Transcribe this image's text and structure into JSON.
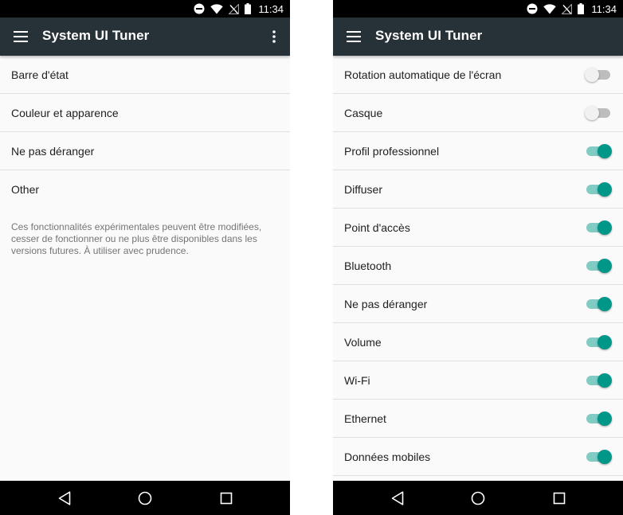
{
  "status_bar": {
    "time": "11:34",
    "icons": [
      "do-not-disturb-icon",
      "wifi-icon",
      "no-signal-icon",
      "battery-icon"
    ]
  },
  "left_screen": {
    "title": "System UI Tuner",
    "items": [
      {
        "label": "Barre d'état"
      },
      {
        "label": "Couleur et apparence"
      },
      {
        "label": "Ne pas déranger"
      },
      {
        "label": "Other"
      }
    ],
    "note": "Ces fonctionnalités expérimentales peuvent être modifiées, cesser de fonctionner ou ne plus être disponibles dans les versions futures. À utiliser avec prudence."
  },
  "right_screen": {
    "title": "System UI Tuner",
    "items": [
      {
        "label": "Rotation automatique de l'écran",
        "enabled": false
      },
      {
        "label": "Casque",
        "enabled": false
      },
      {
        "label": "Profil professionnel",
        "enabled": true
      },
      {
        "label": "Diffuser",
        "enabled": true
      },
      {
        "label": "Point d'accès",
        "enabled": true
      },
      {
        "label": "Bluetooth",
        "enabled": true
      },
      {
        "label": "Ne pas déranger",
        "enabled": true
      },
      {
        "label": "Volume",
        "enabled": true
      },
      {
        "label": "Wi-Fi",
        "enabled": true
      },
      {
        "label": "Ethernet",
        "enabled": true
      },
      {
        "label": "Données mobiles",
        "enabled": true
      }
    ]
  },
  "colors": {
    "app_bar": "#263238",
    "accent": "#009688",
    "accent_track": "#80cbc4",
    "background": "#fafafa"
  }
}
